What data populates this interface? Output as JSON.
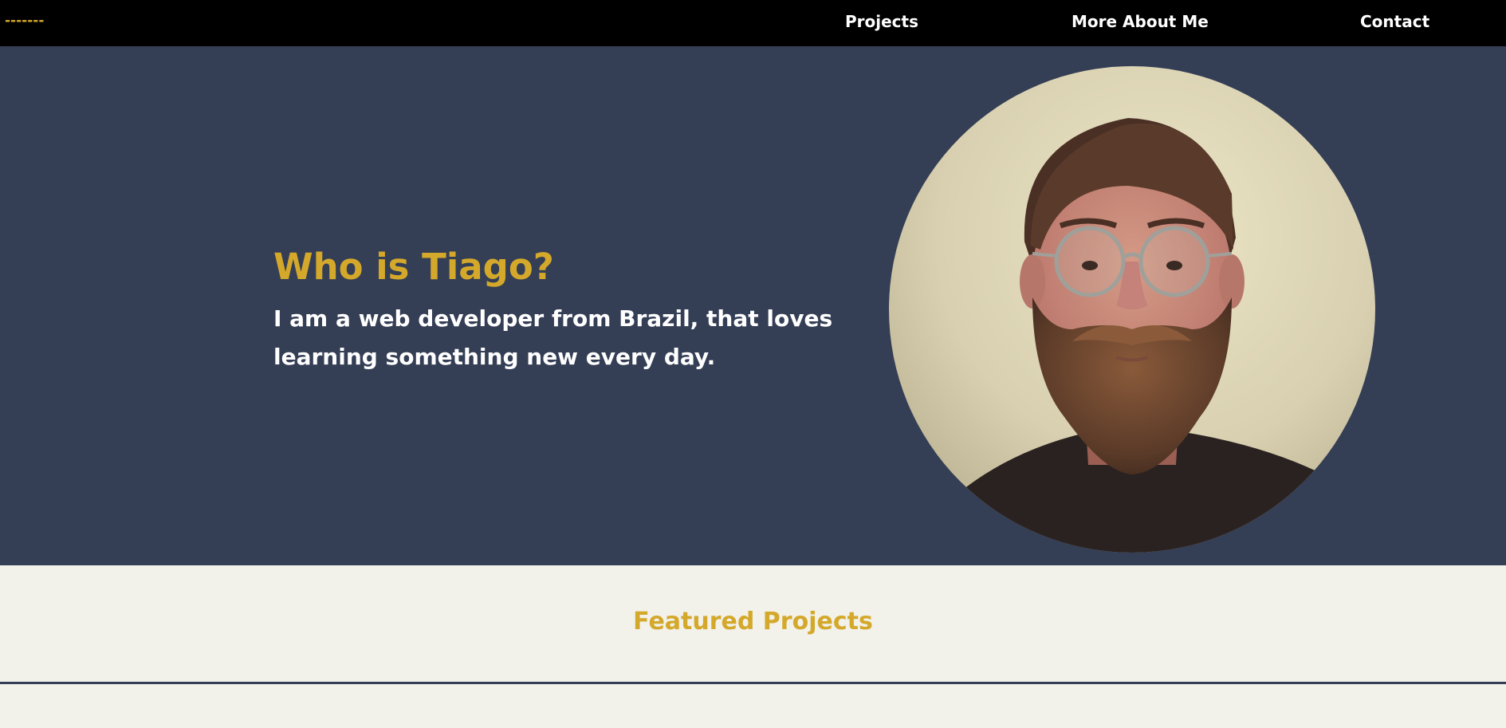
{
  "nav": {
    "logo": "-------",
    "links": [
      "Projects",
      "More About Me",
      "Contact"
    ]
  },
  "hero": {
    "title": "Who is Tiago?",
    "subtitle": "I am a web developer from Brazil, that loves learning something new every day."
  },
  "featured": {
    "title": "Featured Projects"
  },
  "colors": {
    "accent": "#d4a82a",
    "hero_bg": "#343e55",
    "nav_bg": "#000000",
    "page_bg": "#f2f1ea",
    "text_light": "#ffffff"
  },
  "icons": {
    "avatar": "profile-photo"
  }
}
